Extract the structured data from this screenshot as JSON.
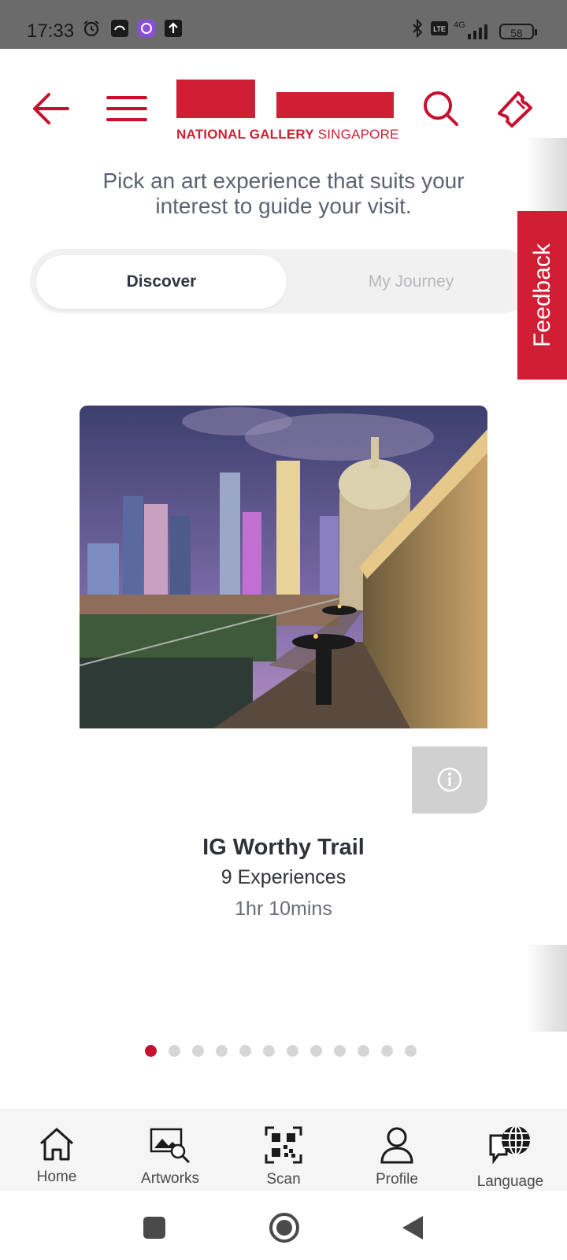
{
  "status_bar": {
    "time": "17:33",
    "battery": "58",
    "network": "4G"
  },
  "header": {
    "logo_text_bold": "NATIONAL GALLERY",
    "logo_text_regular": "SINGAPORE"
  },
  "intro": {
    "line1": "Pick an art experience that suits your",
    "line2": "interest to guide your visit."
  },
  "tabs": [
    {
      "label": "Discover",
      "selected": true
    },
    {
      "label": "My Journey",
      "selected": false
    }
  ],
  "feedback": {
    "label": "Feedback"
  },
  "card": {
    "title": "IG Worthy Trail",
    "experiences": "9 Experiences",
    "duration": "1hr 10mins"
  },
  "carousel": {
    "total_pages": 12,
    "active_index": 0
  },
  "bottom_nav": {
    "items": [
      {
        "label": "Home",
        "icon": "home-icon"
      },
      {
        "label": "Artworks",
        "icon": "artworks-icon"
      },
      {
        "label": "Scan",
        "icon": "qr-scan-icon"
      },
      {
        "label": "Profile",
        "icon": "profile-icon"
      },
      {
        "label": "Language",
        "icon": "language-icon"
      }
    ]
  },
  "colors": {
    "brand_red": "#d01f34",
    "status_bar": "#6b6b6b",
    "nav_bg": "#f5f5f5"
  }
}
